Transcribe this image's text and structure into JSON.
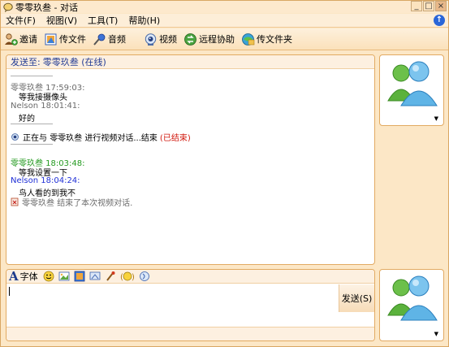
{
  "window": {
    "title": "零零玖叁 - 对话",
    "controls": {
      "minimize": "_",
      "maximize": "□",
      "close": "×"
    }
  },
  "menu": {
    "items": [
      "文件(F)",
      "视图(V)",
      "工具(T)",
      "帮助(H)"
    ],
    "help_glyph": "↑"
  },
  "toolbar": {
    "items": [
      {
        "label": "邀请",
        "icon": "invite-icon"
      },
      {
        "label": "传文件",
        "icon": "send-file-icon"
      },
      {
        "label": "音频",
        "icon": "audio-icon"
      },
      {
        "label": "视频",
        "icon": "webcam-icon"
      },
      {
        "label": "远程协助",
        "icon": "remote-assist-icon"
      },
      {
        "label": "传文件夹",
        "icon": "send-folder-icon"
      }
    ]
  },
  "chat": {
    "to_label": "发送至:",
    "to_name": "零零玖叁 (在线)",
    "messages": [
      {
        "header": "零零玖叁 17:59:03:",
        "text": "等我接摄像头"
      },
      {
        "header": "Nelson 18:01:41:",
        "text": "好的"
      }
    ],
    "status": {
      "prefix": "正在与",
      "name": "零零玖叁",
      "middle": "进行视频对话...结束",
      "ended": "(已结束)"
    },
    "messages2": [
      {
        "header": "零零玖叁 18:03:48:",
        "text": "等我设置一下"
      },
      {
        "header": "Nelson 18:04:24:",
        "text": "鸟人看的到我不"
      }
    ],
    "end_notice": {
      "name": "零零玖叁",
      "text": "结束了本次视频对话."
    }
  },
  "input": {
    "font_label": "字体",
    "font_letter": "A",
    "send_label": "发送(S)",
    "value": ""
  },
  "colors": {
    "window_bg": "#fce7c6",
    "border": "#e2aa62",
    "accent_blue": "#223b94",
    "sender_green": "#239a1f",
    "nelson_blue": "#1f2fd6",
    "ended_red": "#d1170c"
  }
}
